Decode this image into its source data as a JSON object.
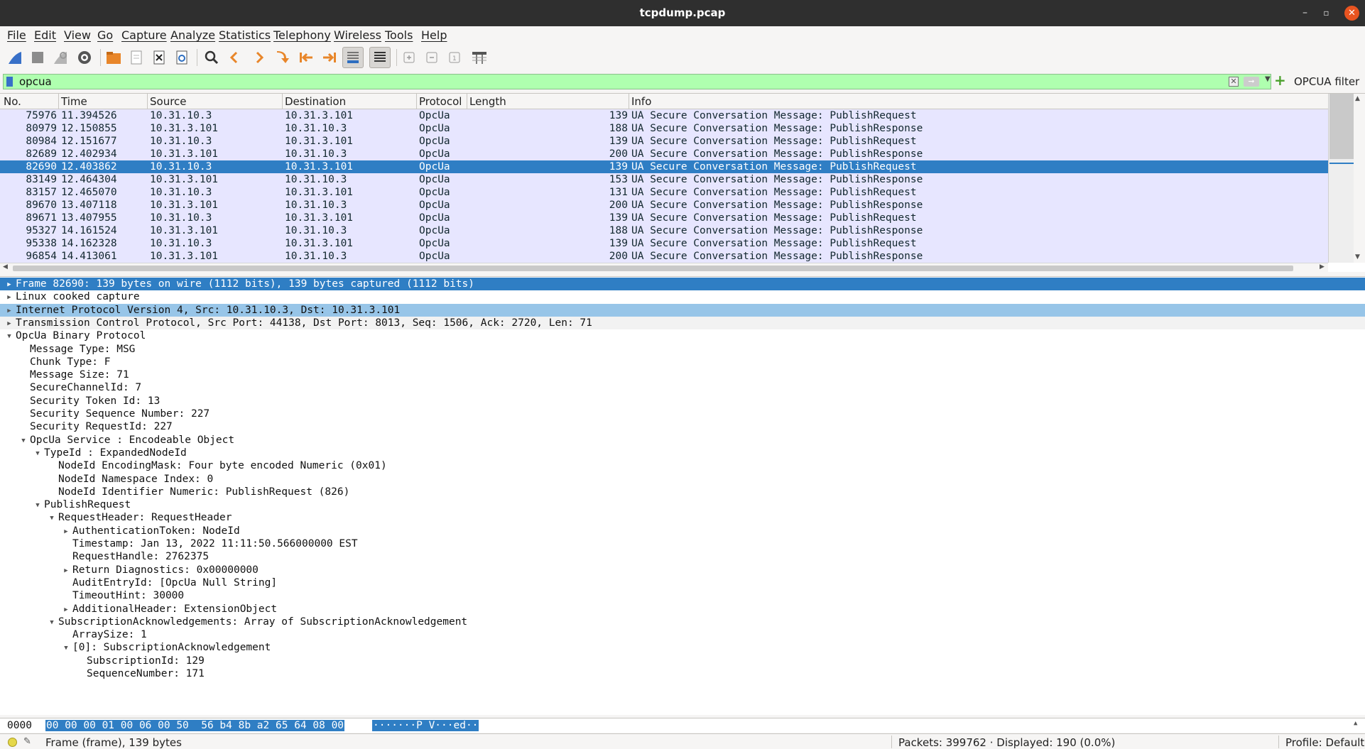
{
  "window": {
    "title": "tcpdump.pcap",
    "minimize": "–",
    "maximize": "▫",
    "close": "✕"
  },
  "menu": [
    "File",
    "Edit",
    "View",
    "Go",
    "Capture",
    "Analyze",
    "Statistics",
    "Telephony",
    "Wireless",
    "Tools",
    "Help"
  ],
  "toolbar": {
    "icons": [
      "shark-fin-start-icon",
      "stop-icon",
      "restart-icon",
      "capture-options-icon",
      "open-file-icon",
      "save-file-icon",
      "close-file-icon",
      "reload-icon",
      "find-icon",
      "go-back-icon",
      "go-forward-icon",
      "go-to-packet-icon",
      "first-packet-icon",
      "last-packet-icon",
      "autoscroll-icon",
      "colorize-icon",
      "zoom-in-icon",
      "zoom-out-icon",
      "normal-size-icon",
      "resize-columns-icon"
    ]
  },
  "filter": {
    "value": "opcua",
    "label": "OPCUA filter"
  },
  "columns": [
    "No.",
    "Time",
    "Source",
    "Destination",
    "Protocol",
    "Length",
    "Info"
  ],
  "packets": [
    {
      "no": "75976",
      "time": "11.394526",
      "src": "10.31.10.3",
      "dst": "10.31.3.101",
      "proto": "OpcUa",
      "len": "139",
      "info": "UA Secure Conversation Message: PublishRequest"
    },
    {
      "no": "80979",
      "time": "12.150855",
      "src": "10.31.3.101",
      "dst": "10.31.10.3",
      "proto": "OpcUa",
      "len": "188",
      "info": "UA Secure Conversation Message: PublishResponse"
    },
    {
      "no": "80984",
      "time": "12.151677",
      "src": "10.31.10.3",
      "dst": "10.31.3.101",
      "proto": "OpcUa",
      "len": "139",
      "info": "UA Secure Conversation Message: PublishRequest"
    },
    {
      "no": "82689",
      "time": "12.402934",
      "src": "10.31.3.101",
      "dst": "10.31.10.3",
      "proto": "OpcUa",
      "len": "200",
      "info": "UA Secure Conversation Message: PublishResponse"
    },
    {
      "no": "82690",
      "time": "12.403862",
      "src": "10.31.10.3",
      "dst": "10.31.3.101",
      "proto": "OpcUa",
      "len": "139",
      "info": "UA Secure Conversation Message: PublishRequest",
      "selected": true
    },
    {
      "no": "83149",
      "time": "12.464304",
      "src": "10.31.3.101",
      "dst": "10.31.10.3",
      "proto": "OpcUa",
      "len": "153",
      "info": "UA Secure Conversation Message: PublishResponse"
    },
    {
      "no": "83157",
      "time": "12.465070",
      "src": "10.31.10.3",
      "dst": "10.31.3.101",
      "proto": "OpcUa",
      "len": "131",
      "info": "UA Secure Conversation Message: PublishRequest"
    },
    {
      "no": "89670",
      "time": "13.407118",
      "src": "10.31.3.101",
      "dst": "10.31.10.3",
      "proto": "OpcUa",
      "len": "200",
      "info": "UA Secure Conversation Message: PublishResponse"
    },
    {
      "no": "89671",
      "time": "13.407955",
      "src": "10.31.10.3",
      "dst": "10.31.3.101",
      "proto": "OpcUa",
      "len": "139",
      "info": "UA Secure Conversation Message: PublishRequest"
    },
    {
      "no": "95327",
      "time": "14.161524",
      "src": "10.31.3.101",
      "dst": "10.31.10.3",
      "proto": "OpcUa",
      "len": "188",
      "info": "UA Secure Conversation Message: PublishResponse"
    },
    {
      "no": "95338",
      "time": "14.162328",
      "src": "10.31.10.3",
      "dst": "10.31.3.101",
      "proto": "OpcUa",
      "len": "139",
      "info": "UA Secure Conversation Message: PublishRequest"
    },
    {
      "no": "96854",
      "time": "14.413061",
      "src": "10.31.3.101",
      "dst": "10.31.10.3",
      "proto": "OpcUa",
      "len": "200",
      "info": "UA Secure Conversation Message: PublishResponse"
    }
  ],
  "details": [
    {
      "text": "Frame 82690: 139 bytes on wire (1112 bits), 139 bytes captured (1112 bits)",
      "level": 0,
      "exp": "collapsed",
      "style": "sel"
    },
    {
      "text": "Linux cooked capture",
      "level": 0,
      "exp": "collapsed",
      "style": ""
    },
    {
      "text": "Internet Protocol Version 4, Src: 10.31.10.3, Dst: 10.31.3.101",
      "level": 0,
      "exp": "collapsed",
      "style": "hl"
    },
    {
      "text": "Transmission Control Protocol, Src Port: 44138, Dst Port: 8013, Seq: 1506, Ack: 2720, Len: 71",
      "level": 0,
      "exp": "collapsed",
      "style": "gray"
    },
    {
      "text": "OpcUa Binary Protocol",
      "level": 0,
      "exp": "expanded",
      "style": ""
    },
    {
      "text": "Message Type: MSG",
      "level": 1,
      "exp": "none",
      "style": ""
    },
    {
      "text": "Chunk Type: F",
      "level": 1,
      "exp": "none",
      "style": ""
    },
    {
      "text": "Message Size: 71",
      "level": 1,
      "exp": "none",
      "style": ""
    },
    {
      "text": "SecureChannelId: 7",
      "level": 1,
      "exp": "none",
      "style": ""
    },
    {
      "text": "Security Token Id: 13",
      "level": 1,
      "exp": "none",
      "style": ""
    },
    {
      "text": "Security Sequence Number: 227",
      "level": 1,
      "exp": "none",
      "style": ""
    },
    {
      "text": "Security RequestId: 227",
      "level": 1,
      "exp": "none",
      "style": ""
    },
    {
      "text": "OpcUa Service : Encodeable Object",
      "level": 1,
      "exp": "expanded",
      "style": ""
    },
    {
      "text": "TypeId : ExpandedNodeId",
      "level": 2,
      "exp": "expanded",
      "style": ""
    },
    {
      "text": "NodeId EncodingMask: Four byte encoded Numeric (0x01)",
      "level": 3,
      "exp": "none",
      "style": ""
    },
    {
      "text": "NodeId Namespace Index: 0",
      "level": 3,
      "exp": "none",
      "style": ""
    },
    {
      "text": "NodeId Identifier Numeric: PublishRequest (826)",
      "level": 3,
      "exp": "none",
      "style": ""
    },
    {
      "text": "PublishRequest",
      "level": 2,
      "exp": "expanded",
      "style": ""
    },
    {
      "text": "RequestHeader: RequestHeader",
      "level": 3,
      "exp": "expanded",
      "style": ""
    },
    {
      "text": "AuthenticationToken: NodeId",
      "level": 4,
      "exp": "collapsed",
      "style": ""
    },
    {
      "text": "Timestamp: Jan 13, 2022 11:11:50.566000000 EST",
      "level": 4,
      "exp": "none",
      "style": ""
    },
    {
      "text": "RequestHandle: 2762375",
      "level": 4,
      "exp": "none",
      "style": ""
    },
    {
      "text": "Return Diagnostics: 0x00000000",
      "level": 4,
      "exp": "collapsed",
      "style": ""
    },
    {
      "text": "AuditEntryId: [OpcUa Null String]",
      "level": 4,
      "exp": "none",
      "style": ""
    },
    {
      "text": "TimeoutHint: 30000",
      "level": 4,
      "exp": "none",
      "style": ""
    },
    {
      "text": "AdditionalHeader: ExtensionObject",
      "level": 4,
      "exp": "collapsed",
      "style": ""
    },
    {
      "text": "SubscriptionAcknowledgements: Array of SubscriptionAcknowledgement",
      "level": 3,
      "exp": "expanded",
      "style": ""
    },
    {
      "text": "ArraySize: 1",
      "level": 4,
      "exp": "none",
      "style": ""
    },
    {
      "text": "[0]: SubscriptionAcknowledgement",
      "level": 4,
      "exp": "expanded",
      "style": ""
    },
    {
      "text": "SubscriptionId: 129",
      "level": 5,
      "exp": "none",
      "style": ""
    },
    {
      "text": "SequenceNumber: 171",
      "level": 5,
      "exp": "none",
      "style": ""
    }
  ],
  "bytes": {
    "offset": "0000",
    "hex": "00 00 00 01 00 06 00 50  56 b4 8b a2 65 64 08 00",
    "ascii": "·······P V···ed··"
  },
  "status": {
    "left": "Frame (frame), 139 bytes",
    "packets": "Packets: 399762 · Displayed: 190 (0.0%)",
    "profile": "Profile: Default"
  }
}
